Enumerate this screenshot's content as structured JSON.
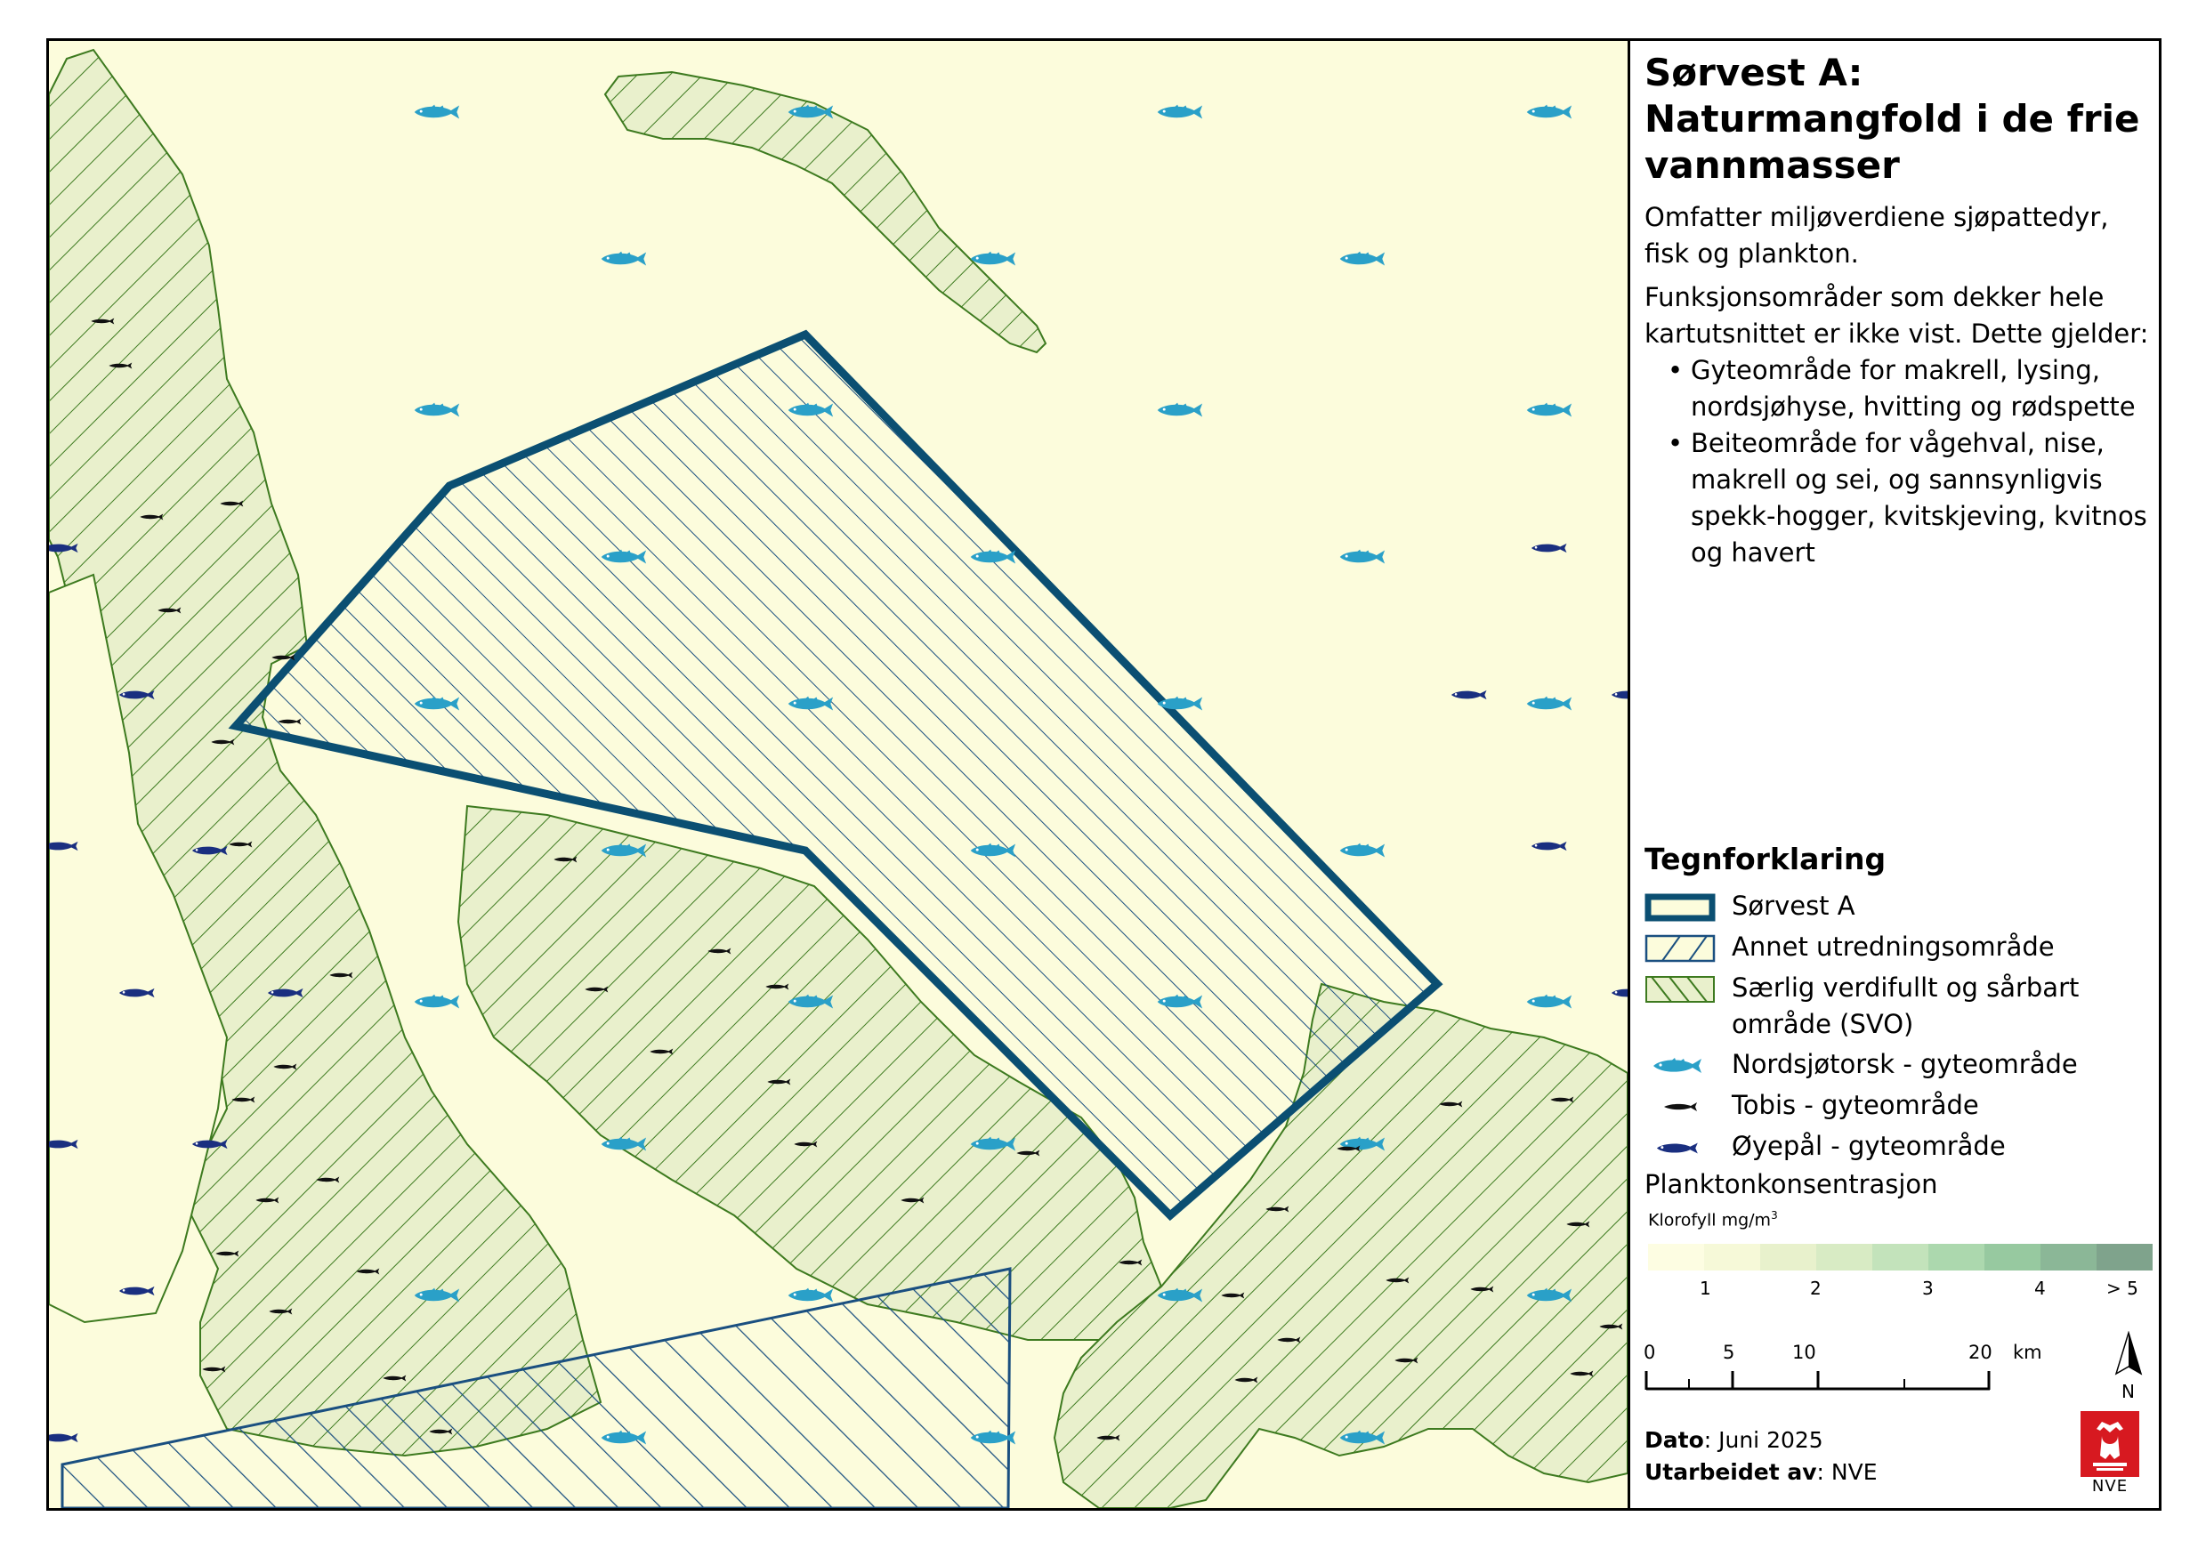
{
  "panel": {
    "title": "Sørvest A:\nNaturmangfold i de frie vannmasser",
    "title_line1": "Sørvest A:",
    "title_line2": "Naturmangfold i de frie",
    "title_line3": "vannmasser",
    "desc1": "Omfatter miljøverdiene sjøpattedyr, fisk og plankton.",
    "desc2": "Funksjonsområder som dekker hele kartutsnittet er ikke vist. Dette gjelder:",
    "bullets": [
      "Gyteområde for makrell, lysing, nordsjøhyse, hvitting og rødspette",
      "Beiteområde for vågehval, nise, makrell og sei, og sannsynligvis spekk-hogger, kvitskjeving, kvitnos og havert"
    ]
  },
  "legend": {
    "title": "Tegnforklaring",
    "items": [
      {
        "label": "Sørvest A",
        "icon": "thick-outline-polygon"
      },
      {
        "label": "Annet utredningsområde",
        "icon": "blue-hatched-polygon"
      },
      {
        "label": "Særlig verdifullt og sårbart område (SVO)",
        "icon": "green-hatched-polygon"
      },
      {
        "label": "Nordsjøtorsk - gyteområde",
        "icon": "cod-icon",
        "color": "#2aa0c8"
      },
      {
        "label": "Tobis - gyteområde",
        "icon": "sandeel-icon",
        "color": "#111111"
      },
      {
        "label": "Øyepål - gyteområde",
        "icon": "norway-pout-icon",
        "color": "#1a2f80"
      }
    ],
    "plankton_title": "Planktonkonsentrasjon",
    "chlorophyll_label": "Klorofyll mg/m",
    "chlorophyll_sup": "3",
    "ramp_colors": [
      "#fdfde2",
      "#f6f9d8",
      "#e8f1cc",
      "#d8ebc4",
      "#c3e3bb",
      "#acd8ae",
      "#97c9a0",
      "#8bb797",
      "#7fa38c"
    ],
    "ramp_labels": [
      "1",
      "2",
      "3",
      "4",
      "> 5"
    ]
  },
  "scalebar": {
    "labels": [
      "0",
      "5",
      "10",
      "20"
    ],
    "unit": "km",
    "north": "N"
  },
  "footer": {
    "date_label": "Dato",
    "date_value": ": Juni 2025",
    "author_label": "Utarbeidet av",
    "author_value": ": NVE",
    "logo_text": "NVE"
  },
  "map_colors": {
    "sea": "#fcfcdc",
    "svo_fill": "#e9f0cc",
    "svo_line": "#3d7a1f",
    "study_line": "#0b4f72",
    "other_line": "#1a4f80"
  }
}
